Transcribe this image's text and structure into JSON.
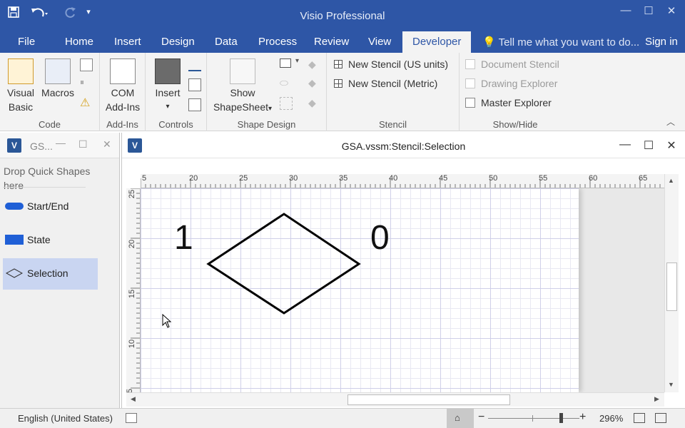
{
  "app": {
    "title": "Visio Professional"
  },
  "qat": {
    "save": "save-icon",
    "undo": "undo-icon",
    "redo": "redo-icon",
    "customize": "customize-icon"
  },
  "tabs": [
    "File",
    "Home",
    "Insert",
    "Design",
    "Data",
    "Process",
    "Review",
    "View",
    "Developer"
  ],
  "active_tab": "Developer",
  "tell_me": "Tell me what you want to do...",
  "sign_in": "Sign in",
  "ribbon": {
    "code": {
      "label": "Code",
      "visual_basic": [
        "Visual",
        "Basic"
      ],
      "macros": "Macros"
    },
    "addins": {
      "label": "Add-Ins",
      "com": [
        "COM",
        "Add-Ins"
      ]
    },
    "controls": {
      "label": "Controls",
      "insert": "Insert"
    },
    "shape_design": {
      "label": "Shape Design",
      "show": "Show",
      "shapesheet": "ShapeSheet"
    },
    "stencil": {
      "label": "Stencil",
      "new_us": "New Stencil (US units)",
      "new_metric": "New Stencil (Metric)"
    },
    "showhide": {
      "label": "Show/Hide",
      "document_stencil": "Document Stencil",
      "drawing_explorer": "Drawing Explorer",
      "master_explorer": "Master Explorer"
    }
  },
  "stencil_pane": {
    "title": "GS...",
    "drop_text": "Drop Quick Shapes here",
    "items": [
      {
        "label": "Start/End",
        "icon": "pill-icon"
      },
      {
        "label": "State",
        "icon": "rectangle-icon"
      },
      {
        "label": "Selection",
        "icon": "diamond-icon"
      }
    ],
    "selected": "Selection"
  },
  "document": {
    "title": "GSA.vssm:Stencil:Selection",
    "ruler_h": [
      "5",
      "20",
      "25",
      "30",
      "35",
      "40",
      "45",
      "50",
      "55",
      "60",
      "65"
    ],
    "ruler_v": [
      "25",
      "20",
      "15",
      "10",
      "5"
    ],
    "shape_labels": {
      "left": "1",
      "right": "0"
    }
  },
  "statusbar": {
    "language": "English (United States)",
    "zoom": "296%"
  },
  "colors": {
    "titlebar": "#2e56a6",
    "accent": "#1f5fd6",
    "selected_item": "#c9d5f1"
  }
}
